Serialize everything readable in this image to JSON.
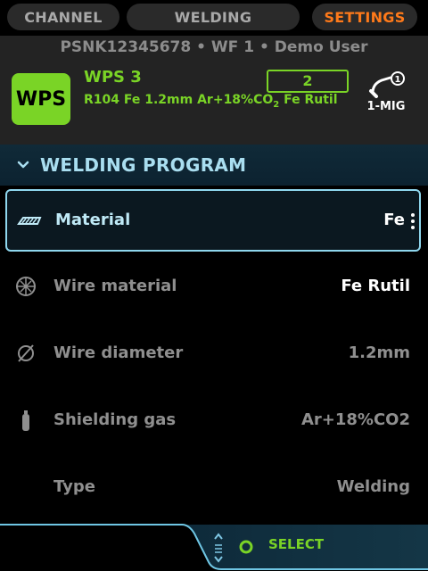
{
  "tabs": [
    {
      "label": "CHANNEL",
      "active": false
    },
    {
      "label": "WELDING",
      "active": false
    },
    {
      "label": "SETTINGS",
      "active": true
    }
  ],
  "header": {
    "serial": "PSNK12345678",
    "wire_feeder": "WF 1",
    "user": "Demo User",
    "wps_logo_text": "WPS",
    "wps_title": "WPS 3",
    "wps_desc_prefix": "R104 Fe 1.2mm Ar+18%CO",
    "wps_desc_sub": "2",
    "wps_desc_suffix": " Fe Rutil",
    "wps_badge": "2",
    "process_label": "1-MIG",
    "process_number": "1"
  },
  "section": {
    "title": "WELDING PROGRAM",
    "expanded": true
  },
  "rows": [
    {
      "label": "Material",
      "value": "Fe",
      "icon": "material-icon",
      "selected": true
    },
    {
      "label": "Wire material",
      "value": "Fe Rutil",
      "icon": "wire-reel-icon",
      "selected": false
    },
    {
      "label": "Wire diameter",
      "value": "1.2mm",
      "icon": "diameter-icon",
      "selected": false
    },
    {
      "label": "Shielding gas",
      "value": "Ar+18%CO2",
      "icon": "gas-cylinder-icon",
      "selected": false
    },
    {
      "label": "Type",
      "value": "Welding",
      "icon": "",
      "selected": false
    }
  ],
  "footer": {
    "action_label": "SELECT"
  },
  "colors": {
    "accent_green": "#7ad426",
    "accent_orange": "#ff7a1a",
    "selection_border": "#8fd7ee",
    "section_bg": "#102a38"
  }
}
